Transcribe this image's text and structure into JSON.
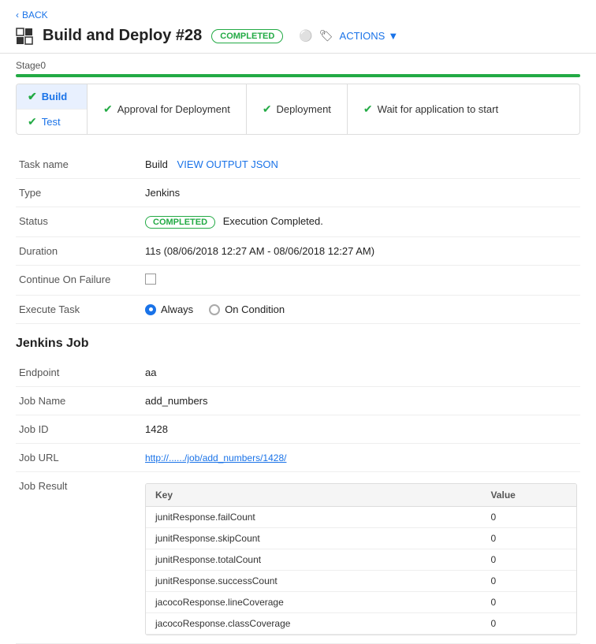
{
  "nav": {
    "back_label": "BACK"
  },
  "header": {
    "title": "Build and Deploy #28",
    "status": "COMPLETED",
    "actions_label": "ACTIONS"
  },
  "stage": {
    "label": "Stage0"
  },
  "tabs_left": [
    {
      "id": "build",
      "label": "Build",
      "active": true
    },
    {
      "id": "test",
      "label": "Test",
      "active": false
    }
  ],
  "tabs_right": [
    {
      "id": "approval",
      "label": "Approval for Deployment"
    },
    {
      "id": "deployment",
      "label": "Deployment"
    },
    {
      "id": "wait",
      "label": "Wait for application to start"
    }
  ],
  "task_info": {
    "task_name_label": "Task name",
    "task_name_value": "Build",
    "view_output_label": "VIEW OUTPUT JSON",
    "type_label": "Type",
    "type_value": "Jenkins",
    "status_label": "Status",
    "status_badge": "COMPLETED",
    "status_text": "Execution Completed.",
    "duration_label": "Duration",
    "duration_value": "11s (08/06/2018 12:27 AM - 08/06/2018 12:27 AM)",
    "continue_label": "Continue On Failure",
    "execute_label": "Execute Task",
    "radio_always": "Always",
    "radio_condition": "On Condition"
  },
  "jenkins_job": {
    "section_title": "Jenkins Job",
    "endpoint_label": "Endpoint",
    "endpoint_value": "aa",
    "job_name_label": "Job Name",
    "job_name_value": "add_numbers",
    "job_id_label": "Job ID",
    "job_id_value": "1428",
    "job_url_label": "Job URL",
    "job_url_value": "http://....../job/add_numbers/1428/",
    "job_result_label": "Job Result",
    "result_col_key": "Key",
    "result_col_value": "Value",
    "results": [
      {
        "key": "junitResponse.failCount",
        "value": "0"
      },
      {
        "key": "junitResponse.skipCount",
        "value": "0"
      },
      {
        "key": "junitResponse.totalCount",
        "value": "0"
      },
      {
        "key": "junitResponse.successCount",
        "value": "0"
      },
      {
        "key": "jacocoResponse.lineCoverage",
        "value": "0"
      },
      {
        "key": "jacocoResponse.classCoverage",
        "value": "0"
      }
    ]
  }
}
